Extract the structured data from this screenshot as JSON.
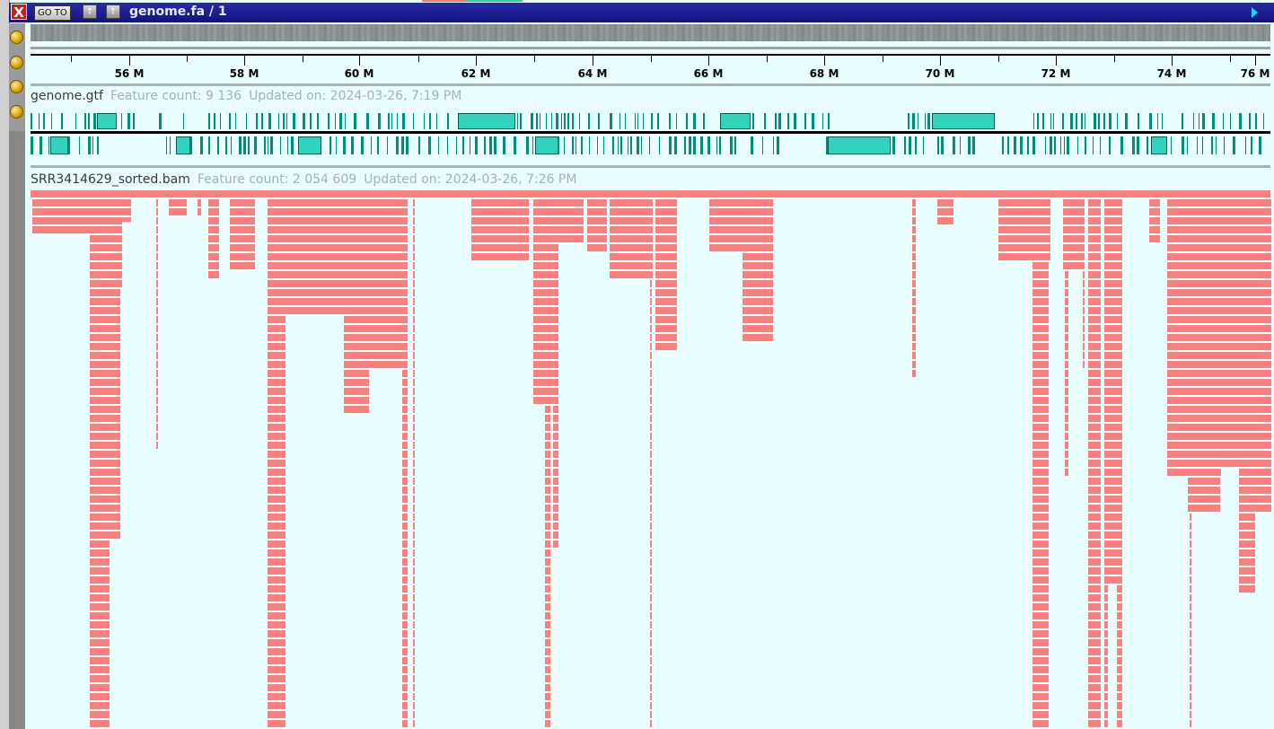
{
  "window": {
    "title": "genome.fa / 1",
    "close_label": "X",
    "goto_label": "GO TO",
    "up_label": "↑",
    "down_label": "↑"
  },
  "ruler": {
    "ticks": [
      "56 M",
      "58 M",
      "60 M",
      "62 M",
      "64 M",
      "66 M",
      "68 M",
      "70 M",
      "72 M",
      "74 M",
      "76 M"
    ]
  },
  "tracks": [
    {
      "name": "genome.gtf",
      "feature_count": "Feature count: 9 136",
      "updated": "Updated on: 2024-03-26, 7:19 PM"
    },
    {
      "name": "SRR3414629_sorted.bam",
      "feature_count": "Feature count: 2 054 609",
      "updated": "Updated on: 2024-03-26, 7:26 PM"
    }
  ],
  "colors": {
    "background": "#e9ffff",
    "gene": "#008e78",
    "exon": "#33d2bd",
    "read": "#fa8080",
    "title_bar": "#1a1a8c"
  },
  "icons": {
    "close": "close-icon",
    "goto": "goto-button",
    "collapse": "collapse-up-icon",
    "expand": "expand-up-icon",
    "sidebar": "sidebar-dot-icon",
    "navigate_right": "triangle-right-icon"
  }
}
